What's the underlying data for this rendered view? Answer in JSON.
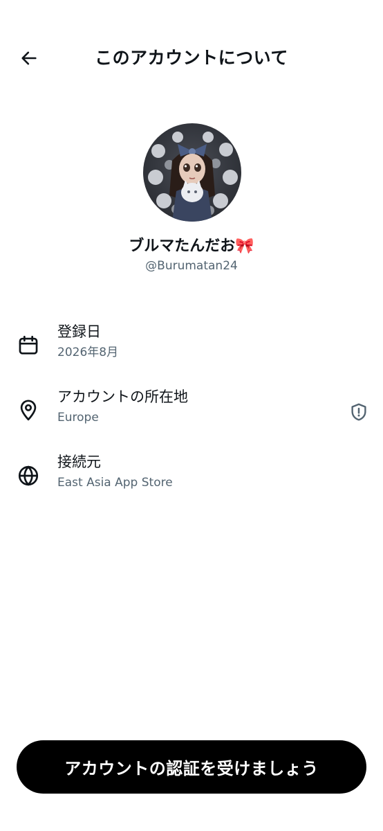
{
  "header": {
    "title": "このアカウントについて",
    "back_icon": "arrow-left-icon"
  },
  "profile": {
    "display_name": "ブルマたんだお🎀",
    "handle": "@Burumatan24"
  },
  "info": [
    {
      "icon": "calendar-icon",
      "label": "登録日",
      "value": "2026年8月"
    },
    {
      "icon": "location-pin-icon",
      "label": "アカウントの所在地",
      "value": "Europe",
      "trailing_icon": "shield-alert-icon"
    },
    {
      "icon": "globe-icon",
      "label": "接続元",
      "value": "East Asia App Store"
    }
  ],
  "cta": {
    "label": "アカウントの認証を受けましょう"
  }
}
